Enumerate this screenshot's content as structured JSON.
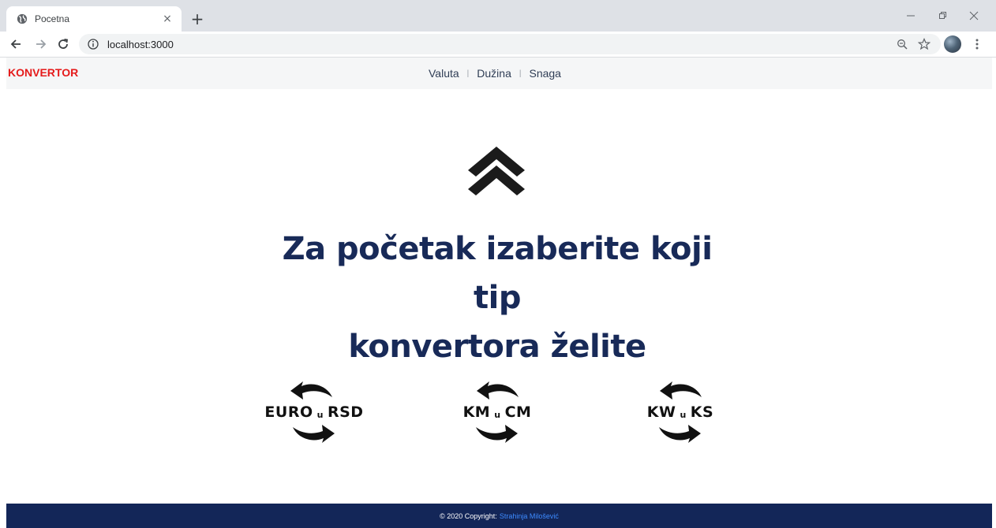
{
  "browser": {
    "tab_title": "Pocetna",
    "tab_close": "×",
    "new_tab": "+",
    "url": "localhost:3000"
  },
  "navbar": {
    "brand": "KONVERTOR",
    "brand_color": "#e51b1b",
    "items": [
      {
        "label": "Valuta"
      },
      {
        "label": "Dužina"
      },
      {
        "label": "Snaga"
      }
    ],
    "separator": "|"
  },
  "hero": {
    "icon": "double-chevron-up-icon",
    "title_line1": "Za početak izaberite koji tip",
    "title_line2": "konvertora želite",
    "title_color": "#182a58"
  },
  "converters": [
    {
      "from": "EURO",
      "joiner": "u",
      "to": "RSD",
      "icon": "convert-arrows-icon"
    },
    {
      "from": "KM",
      "joiner": "u",
      "to": "CM",
      "icon": "convert-arrows-icon"
    },
    {
      "from": "KW",
      "joiner": "u",
      "to": "KS",
      "icon": "convert-arrows-icon"
    }
  ],
  "footer": {
    "copyright": "© 2020 Copyright:",
    "author": "Strahinja Milošević",
    "background": "#132658",
    "link_color": "#3d8bff"
  }
}
